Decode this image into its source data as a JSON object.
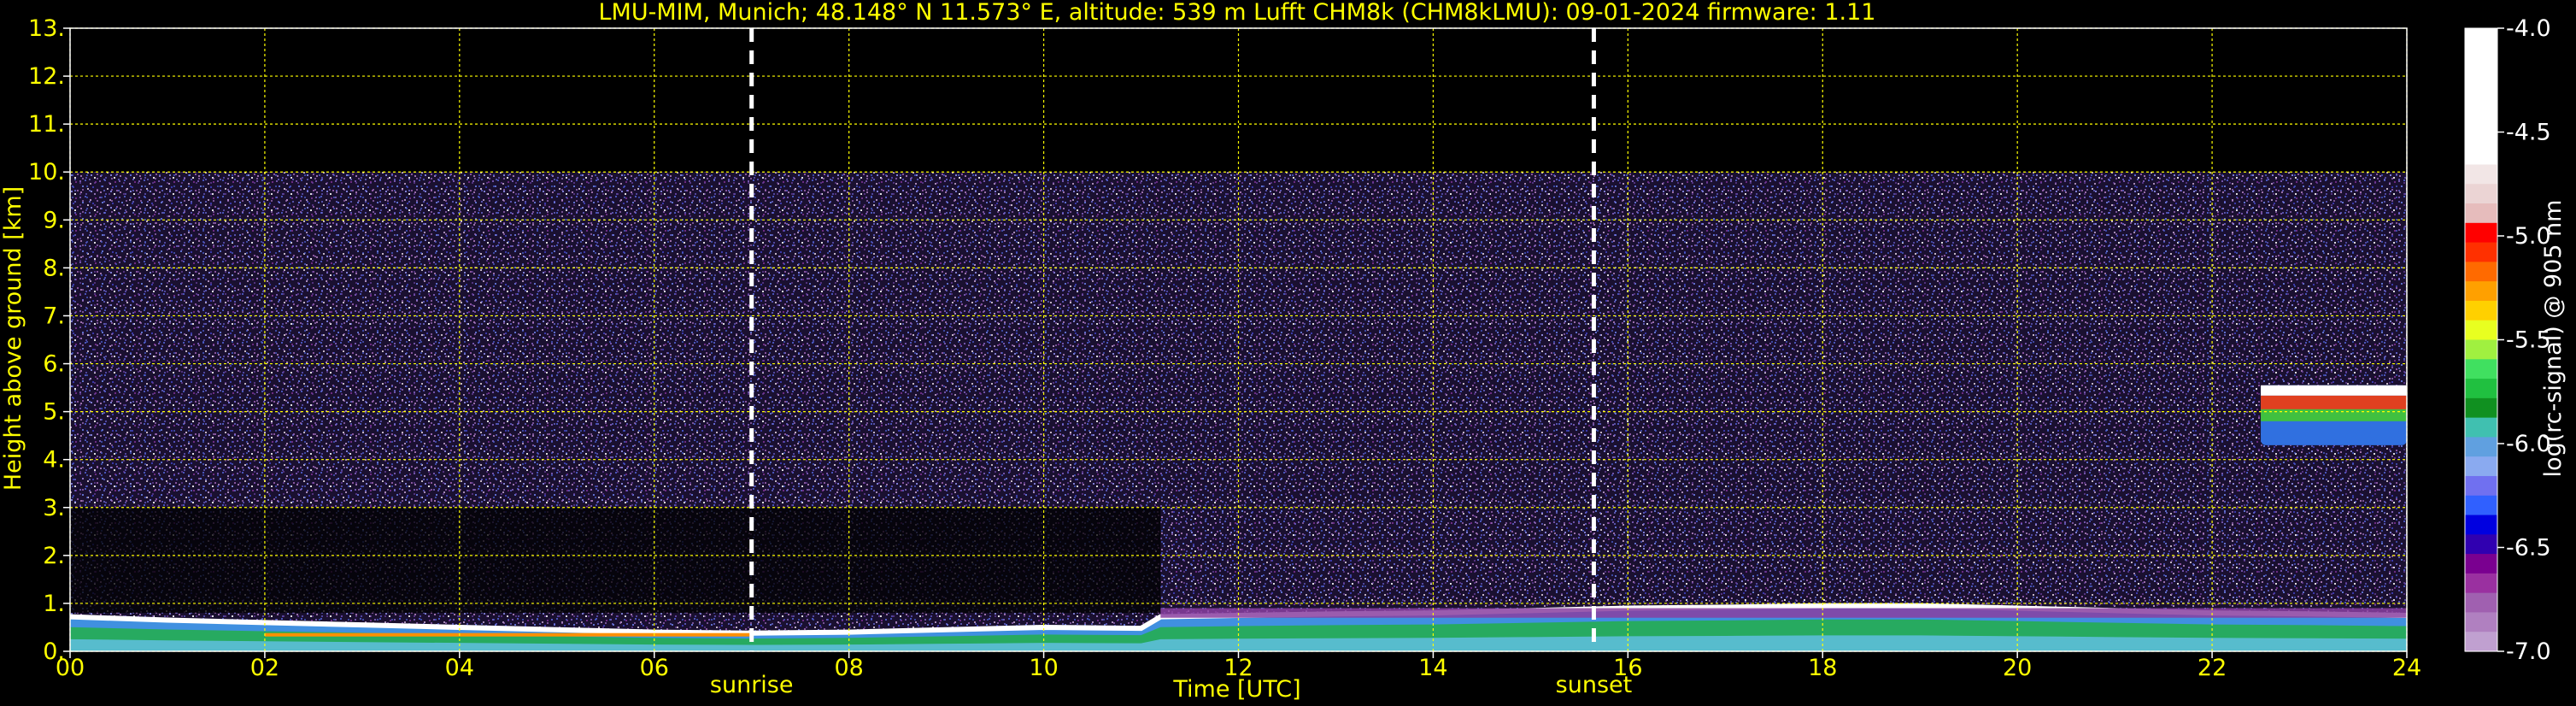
{
  "title": "LMU-MIM, Munich; 48.148° N 11.573° E, altitude: 539 m    Lufft CHM8k (CHM8kLMU): 09-01-2024    firmware: 1.11",
  "chart_data": {
    "type": "heatmap",
    "xlabel": "Time [UTC]",
    "ylabel": "Height above ground [km]",
    "xlim": [
      0,
      24
    ],
    "ylim": [
      0,
      13
    ],
    "x_ticks": [
      "00",
      "02",
      "04",
      "06",
      "08",
      "10",
      "12",
      "14",
      "16",
      "18",
      "20",
      "22",
      "24"
    ],
    "x_tick_values": [
      0,
      2,
      4,
      6,
      8,
      10,
      12,
      14,
      16,
      18,
      20,
      22,
      24
    ],
    "y_ticks": [
      "0.",
      "1.",
      "2.",
      "3.",
      "4.",
      "5.",
      "6.",
      "7.",
      "8.",
      "9.",
      "10.",
      "11.",
      "12.",
      "13."
    ],
    "y_tick_values": [
      0,
      1,
      2,
      3,
      4,
      5,
      6,
      7,
      8,
      9,
      10,
      11,
      12,
      13
    ],
    "grid": true,
    "markers": [
      {
        "label": "sunrise",
        "x": 7.0
      },
      {
        "label": "sunset",
        "x": 15.65
      }
    ],
    "measurement_top_km": 10.0,
    "layers": [
      {
        "type": "boundary_layer",
        "x": [
          0,
          1,
          2,
          3,
          4,
          5,
          6,
          7,
          8,
          9,
          10,
          11,
          11.2,
          12,
          13,
          14,
          15,
          16,
          17,
          18,
          19,
          20,
          21,
          22,
          23,
          24
        ],
        "top_km": [
          0.72,
          0.65,
          0.6,
          0.55,
          0.5,
          0.45,
          0.4,
          0.38,
          0.4,
          0.45,
          0.5,
          0.48,
          0.72,
          0.75,
          0.78,
          0.8,
          0.85,
          0.9,
          0.92,
          0.95,
          0.95,
          0.9,
          0.85,
          0.8,
          0.78,
          0.75
        ]
      },
      {
        "type": "cloud",
        "x_start": 22.5,
        "x_end": 24,
        "base_km": 4.3,
        "top_km": 5.55
      }
    ],
    "colorbar": {
      "label": "log(rc-signal) @ 905 nm",
      "min": -7.0,
      "max": -4.0,
      "ticks": [
        "-4.0",
        "-4.5",
        "-5.0",
        "-5.5",
        "-6.0",
        "-6.5",
        "-7.0"
      ],
      "tick_values": [
        -4.0,
        -4.5,
        -5.0,
        -5.5,
        -6.0,
        -6.5,
        -7.0
      ],
      "colors": [
        "#ffffff",
        "#ffffff",
        "#ffffff",
        "#ffffff",
        "#ffffff",
        "#ffffff",
        "#ffffff",
        "#f2e6e6",
        "#ebd4d4",
        "#e6bcbc",
        "#ff0000",
        "#ff3000",
        "#ff6a00",
        "#ffa000",
        "#ffd000",
        "#e8ff20",
        "#a0f040",
        "#40e060",
        "#20c040",
        "#109020",
        "#40c0b0",
        "#60a0e0",
        "#8aaaf0",
        "#7070f0",
        "#3060ff",
        "#0000e0",
        "#3000b0",
        "#7a0090",
        "#9a30a0",
        "#a060b0",
        "#b080c0",
        "#c0a0d0"
      ]
    }
  }
}
